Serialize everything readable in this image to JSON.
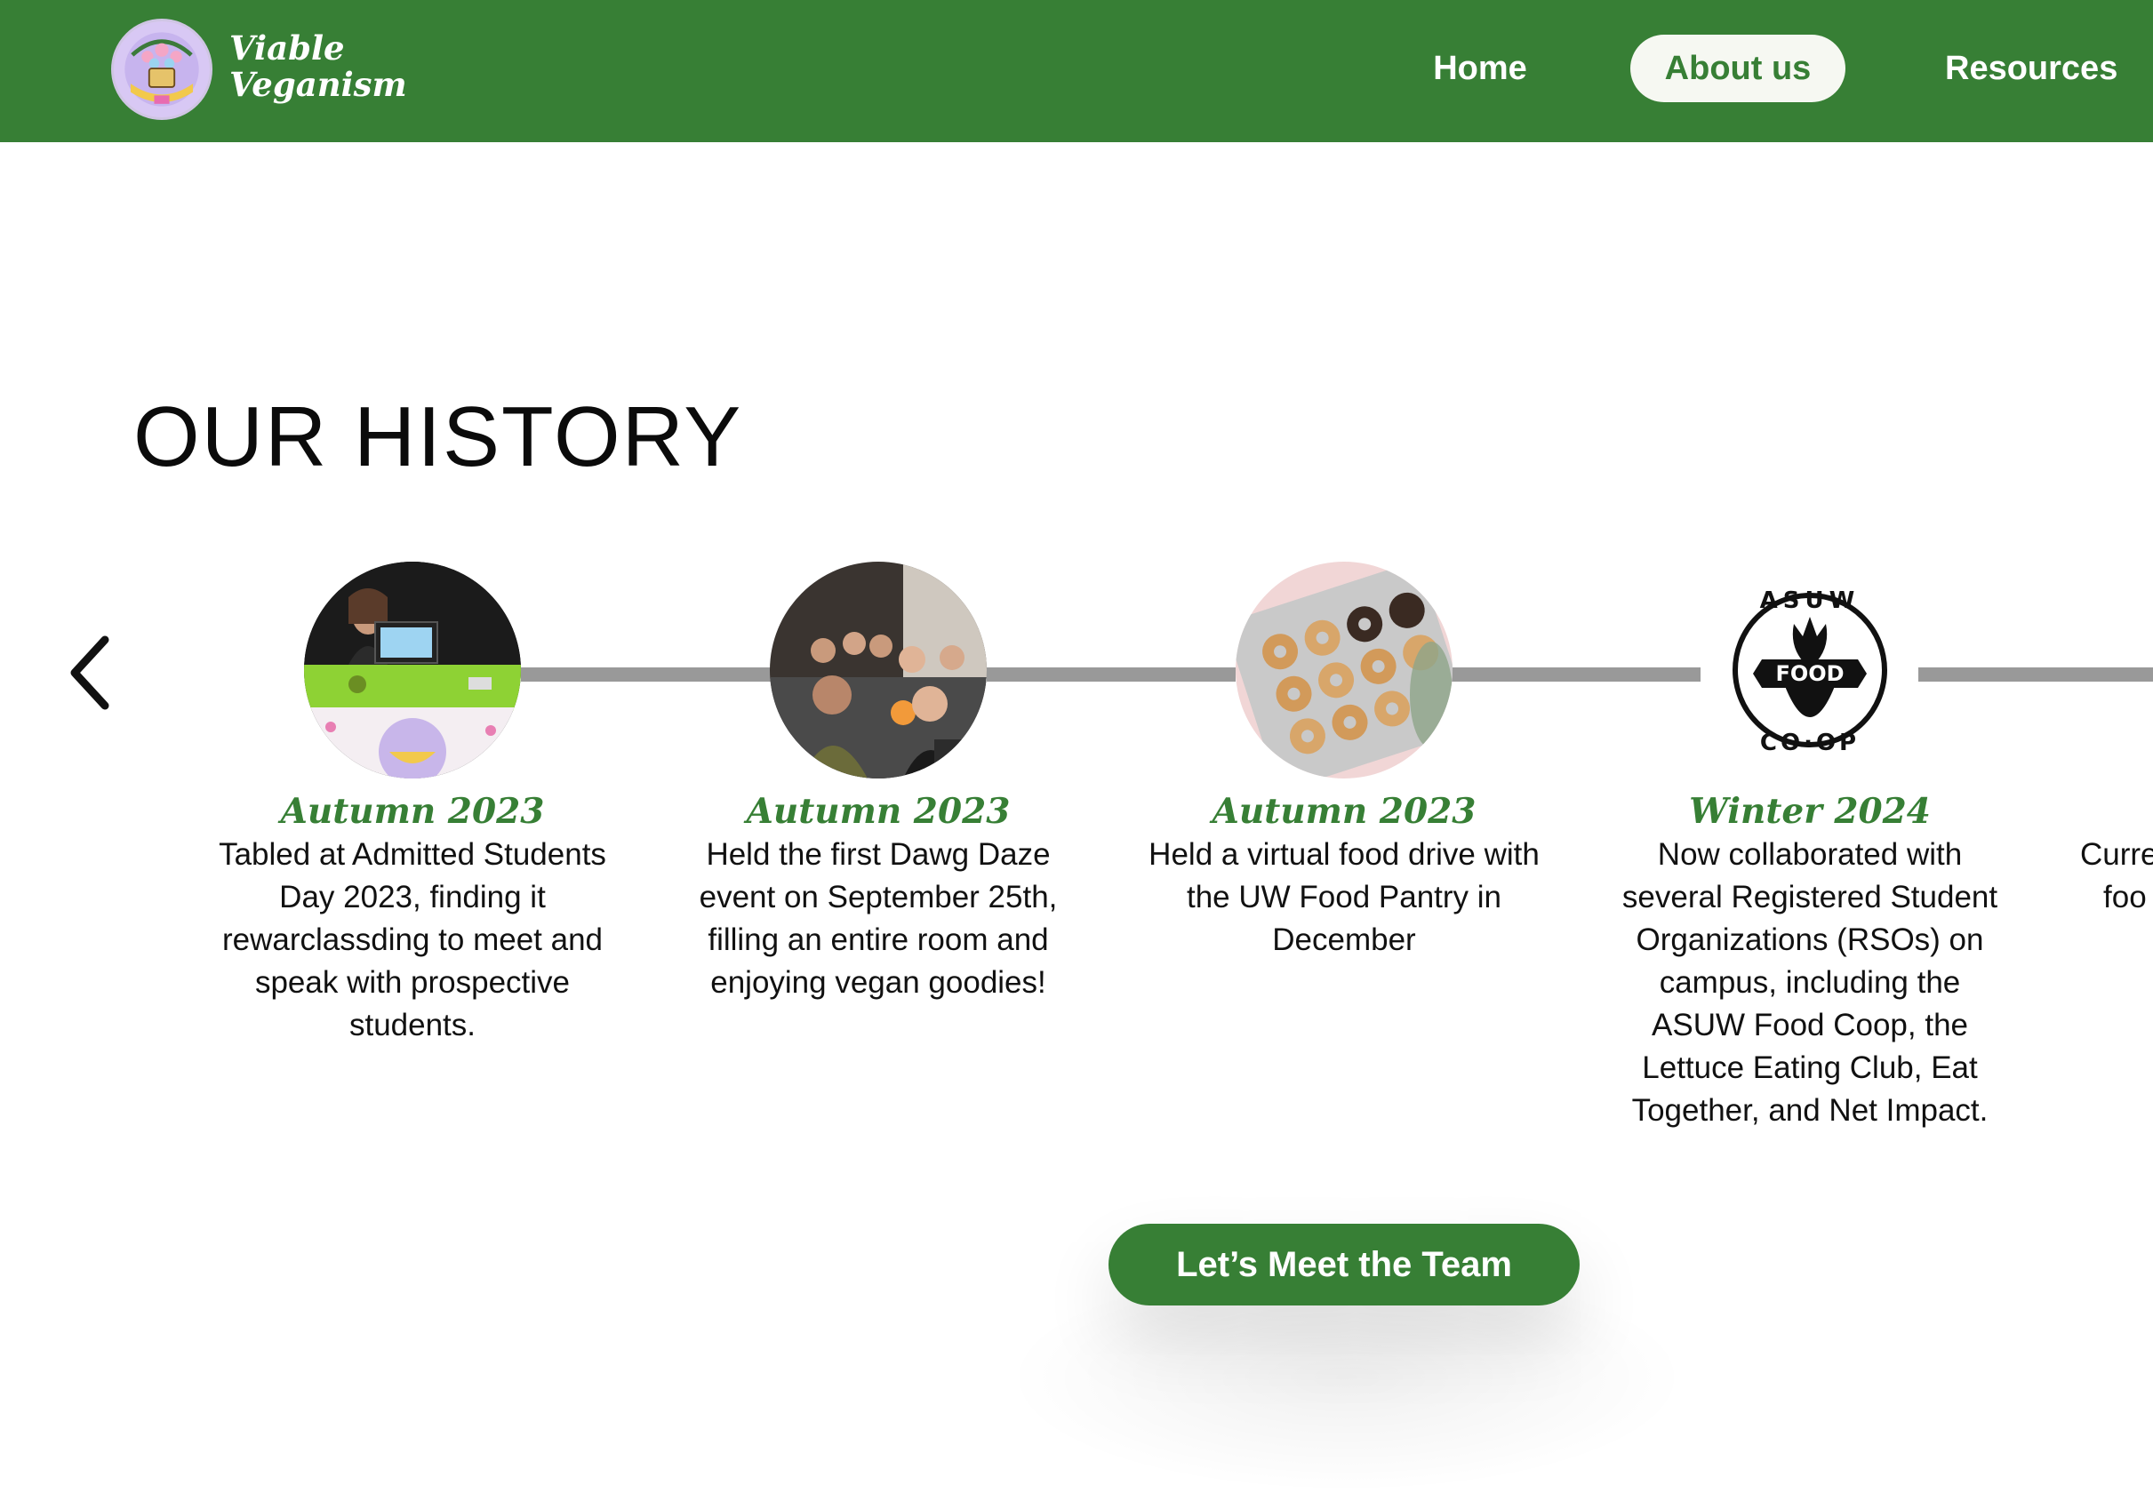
{
  "nav": {
    "brand_line1": "Viable",
    "brand_line2": "Veganism",
    "links": [
      {
        "label": "Home"
      },
      {
        "label": "About us",
        "active": true
      },
      {
        "label": "Resources"
      }
    ]
  },
  "page": {
    "title": "OUR HISTORY"
  },
  "timeline": [
    {
      "season": "Autumn 2023",
      "text": "Tabled at Admitted Students Day 2023, finding it rewarclassding to meet and speak with prospective students."
    },
    {
      "season": "Autumn 2023",
      "text": "Held the first Dawg Daze event on September 25th, filling an entire room and enjoying vegan goodies!"
    },
    {
      "season": "Autumn 2023",
      "text": "Held a virtual food drive with the UW Food Pantry in December"
    },
    {
      "season": "Winter 2024",
      "text": "Now collaborated with several Registered Student Organizations (RSOs) on campus, including the ASUW Food Coop, the Lettuce Eating Club, Eat Together, and Net Impact."
    },
    {
      "season": "",
      "text": "Curre foo"
    }
  ],
  "coop_logo": {
    "top": "ASUW",
    "middle": "FOOD",
    "bottom": "CO·OP"
  },
  "cta": {
    "label": "Let’s Meet the Team"
  },
  "colors": {
    "brand_green": "#377f35",
    "timeline_gray": "#999999"
  }
}
